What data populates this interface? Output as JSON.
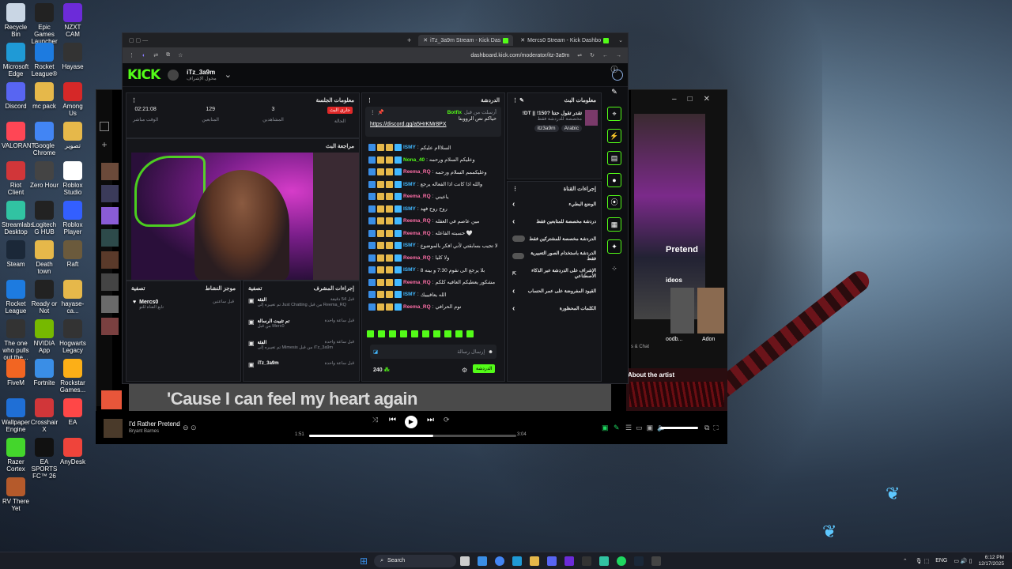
{
  "desktop": {
    "icons": [
      {
        "label": "Recycle Bin",
        "color": "#c9d6e4"
      },
      {
        "label": "Epic Games Launcher",
        "color": "#222222"
      },
      {
        "label": "NZXT CAM",
        "color": "#6c2bd9"
      },
      {
        "label": "Microsoft Edge",
        "color": "#1f9ad6"
      },
      {
        "label": "Rocket League®",
        "color": "#1d7be0"
      },
      {
        "label": "Hayase",
        "color": "#333333"
      },
      {
        "label": "Discord",
        "color": "#5865f2"
      },
      {
        "label": "mc pack",
        "color": "#e6b84a"
      },
      {
        "label": "Among Us",
        "color": "#d62828"
      },
      {
        "label": "VALORANT",
        "color": "#ff4655"
      },
      {
        "label": "Google Chrome",
        "color": "#4285f4"
      },
      {
        "label": "تصوير",
        "color": "#e6b84a"
      },
      {
        "label": "Riot Client",
        "color": "#d13639"
      },
      {
        "label": "Zero Hour",
        "color": "#444444"
      },
      {
        "label": "Roblox Studio",
        "color": "#ffffff"
      },
      {
        "label": "Streamlabs Desktop",
        "color": "#31c3a2"
      },
      {
        "label": "Logitech G HUB",
        "color": "#222222"
      },
      {
        "label": "Roblox Player",
        "color": "#335fff"
      },
      {
        "label": "Steam",
        "color": "#1b2838"
      },
      {
        "label": "Death town",
        "color": "#e6b84a"
      },
      {
        "label": "Raft",
        "color": "#6b5a3c"
      },
      {
        "label": "Rocket League",
        "color": "#1d7be0"
      },
      {
        "label": "Ready or Not",
        "color": "#222222"
      },
      {
        "label": "hayase-ca...",
        "color": "#e6b84a"
      },
      {
        "label": "The one who pulls out the...",
        "color": "#333333"
      },
      {
        "label": "NVIDIA App",
        "color": "#76b900"
      },
      {
        "label": "Hogwarts Legacy",
        "color": "#333333"
      },
      {
        "label": "FiveM",
        "color": "#f26522"
      },
      {
        "label": "Fortnite",
        "color": "#3a8ee6"
      },
      {
        "label": "Rockstar Games...",
        "color": "#fcaf17"
      },
      {
        "label": "Wallpaper Engine",
        "color": "#1f6fd6"
      },
      {
        "label": "Crosshair X",
        "color": "#d13639"
      },
      {
        "label": "EA",
        "color": "#ff4747"
      },
      {
        "label": "Razer Cortex",
        "color": "#44d62c"
      },
      {
        "label": "EA SPORTS FC™ 26",
        "color": "#111111"
      },
      {
        "label": "AnyDesk",
        "color": "#ef443b"
      },
      {
        "label": "RV There Yet",
        "color": "#b55a2b"
      }
    ]
  },
  "browser": {
    "tabs": [
      {
        "label": "iTz_3a9m Stream - Kick Das"
      },
      {
        "label": "Mercs0 Stream - Kick Dashbo"
      }
    ],
    "url": "dashboard.kick.com/moderator/itz-3a9m",
    "kick_logo": "KICK",
    "channel_name": "iTz_3a9m",
    "channel_sub": "مخول الإشراف"
  },
  "session_info": {
    "title": "معلومات الجلسة",
    "live_badge": "جاري البث",
    "live_label": "الحالة",
    "viewers_value": "3",
    "viewers_label": "المشاهدين",
    "followers_value": "129",
    "followers_label": "المتابعين",
    "uptime_value": "02:21:08",
    "uptime_label": "الوقت مباشر"
  },
  "stream_preview": {
    "title": "مراجعة البث"
  },
  "activity": {
    "title": "موجز النشاط",
    "filter": "تصفية",
    "user": "Mercs0",
    "action": "تابع القناة للتو",
    "time": "قبل ساعتين"
  },
  "mod_actions": {
    "title": "إجراءات المشرف",
    "filter": "تصفية",
    "items": [
      {
        "title": "الفئة",
        "detail": "تم تغييره إلى Just Chatting من قبل Reema_RQ",
        "time": "قبل 54 دقيقة"
      },
      {
        "title": "تم تثبيت الرسالة",
        "detail": "من قبل Merc0",
        "time": "قبل ساعة واحدة"
      },
      {
        "title": "الفئة",
        "detail": "تم تغييره إلى Mimesis من قبل iTz_3a9m",
        "time": "قبل ساعة واحدة"
      },
      {
        "title": "iTz_3a9m",
        "detail": "",
        "time": "قبل ساعة واحدة"
      }
    ]
  },
  "chat": {
    "title": "الدردشة",
    "pinned_user": "Botfix",
    "pinned_text": "حياكم نص الرووبتا",
    "pinned_link": "https://discord.gg/a5HrKMr8PX",
    "pinned_by": "أرسلت من قبل",
    "messages": [
      {
        "user": "ISMY",
        "text": "السلااام عليكم",
        "color": "#42b8ff"
      },
      {
        "user": "Nona_40",
        "text": "وعليكم السلام ورحمه",
        "color": "#53fc18"
      },
      {
        "user": "Reema_RQ",
        "text": "وعليكممم السلام ورحمه",
        "color": "#ff6fa8"
      },
      {
        "user": "ISMY",
        "text": "والله اذا كانت اذا الفعاله يرجع",
        "color": "#42b8ff"
      },
      {
        "user": "Reema_RQ",
        "text": "ياعيني",
        "color": "#ff6fa8"
      },
      {
        "user": "ISMY",
        "text": "روح روح فهد",
        "color": "#42b8ff"
      },
      {
        "user": "Reema_RQ",
        "text": "مين عاصم في العقله",
        "color": "#ff6fa8"
      },
      {
        "user": "Reema_RQ",
        "text": "حسبته الفاعله 🤍",
        "color": "#ff6fa8"
      },
      {
        "user": "ISMY",
        "text": "لا تجيب بسابقتي لأني افكر بالموضوع",
        "color": "#42b8ff"
      },
      {
        "user": "Reema_RQ",
        "text": "ولا كليا",
        "color": "#ff6fa8"
      },
      {
        "user": "ISMY",
        "text": "8 بلا يرجع الى نقوم 7:30 و بينه",
        "color": "#42b8ff"
      },
      {
        "user": "Reema_RQ",
        "text": "مشكور يعطيكم العافيه كلكم",
        "color": "#ff6fa8"
      },
      {
        "user": "ISMY",
        "text": "الله يعافيييك",
        "color": "#42b8ff"
      },
      {
        "user": "Reema_RQ",
        "text": "نوم الحرافي",
        "color": "#ff6fa8"
      }
    ],
    "input_placeholder": "إرسال رسالة",
    "points": "240",
    "send_label": "الدردشة"
  },
  "stream_info": {
    "title": "معلومات البث",
    "stream_title": "!DT || !150? تقدر تقول حنتا",
    "stream_subtitle": "مخصصة للدردشة فقط",
    "tags": [
      "Arabic",
      "itz3a9m"
    ]
  },
  "channel_actions": {
    "title": "إجراءات القناة",
    "items": [
      {
        "label": "الوضع البطيء",
        "type": "arrow"
      },
      {
        "label": "دردشة مخصصة للمتابعين فقط",
        "type": "arrow"
      },
      {
        "label": "الدردشة مخصصة للمشتركين فقط",
        "type": "toggle"
      },
      {
        "label": "الدردشة باستخدام الصور التعبيرية فقط",
        "type": "toggle"
      },
      {
        "label": "الإشراف على الدردشة عبر الذكاء الاصطناعي",
        "type": "ext"
      },
      {
        "label": "القيود المفروضة على عمر الحساب",
        "type": "arrow"
      },
      {
        "label": "الكلمات المحظورة",
        "type": "arrow"
      }
    ]
  },
  "spotify": {
    "lyric": "'Cause I can feel my heart again",
    "track": "I'd Rather Pretend",
    "artist": "Bryant Barnes",
    "elapsed": "1:51",
    "duration": "3:04",
    "progress": 0.6,
    "side_label": "Pretend",
    "videos_label": "ideos",
    "about_label": "About the artist",
    "thumb_labels": [
      "oodb...",
      "Adon"
    ],
    "lyrics_chat": "s & Chat"
  },
  "taskbar": {
    "search": "Search",
    "lang": "ENG",
    "time": "6:12 PM",
    "date": "12/17/2025"
  }
}
